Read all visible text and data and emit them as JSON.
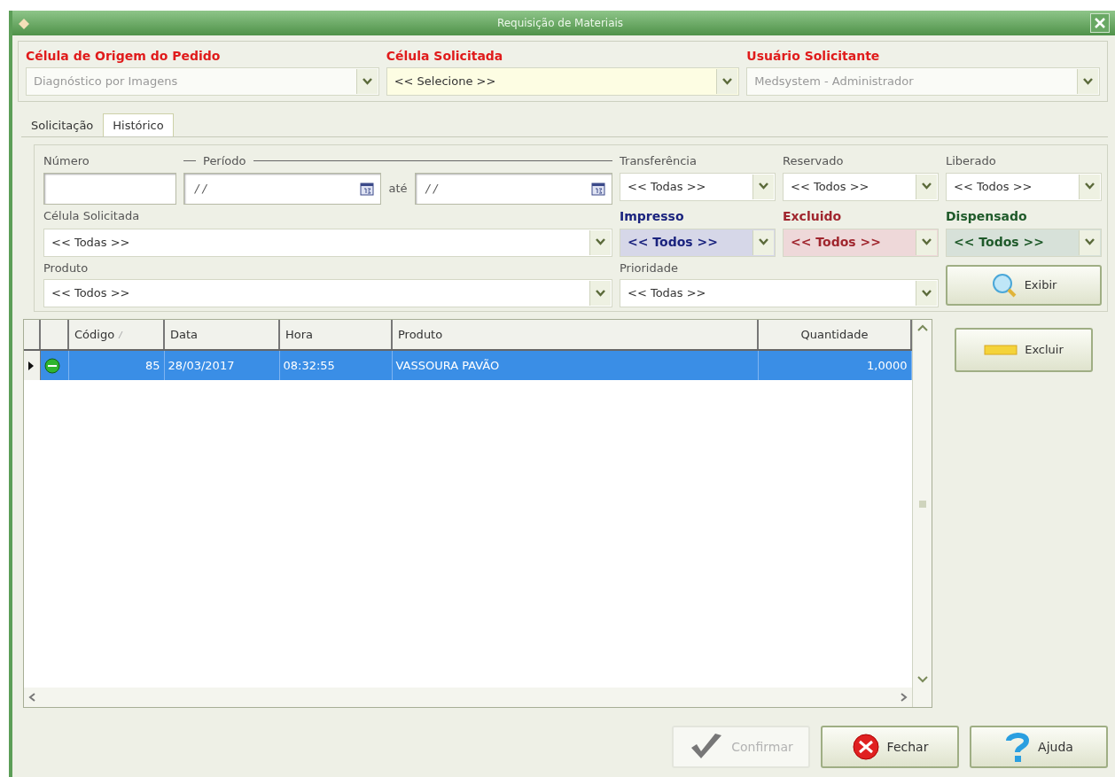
{
  "window": {
    "title": "Requisição de Materiais"
  },
  "header_fields": [
    {
      "label": "Célula de Origem do Pedido",
      "value": "Diagnóstico por Imagens",
      "disabled": true
    },
    {
      "label": "Célula Solicitada",
      "value": "<< Selecione >>",
      "disabled": false
    },
    {
      "label": "Usuário Solicitante",
      "value": "Medsystem - Administrador",
      "disabled": true
    }
  ],
  "tabs": [
    {
      "label": "Solicitação",
      "selected": false
    },
    {
      "label": "Histórico",
      "selected": true
    }
  ],
  "filters": {
    "number": {
      "label": "Número"
    },
    "period": {
      "label": "Período",
      "start": "/ /",
      "separator": "até",
      "end": "/ /"
    },
    "flag_filters": [
      {
        "label": "Transferência",
        "value": "<< Todas >>"
      },
      {
        "label": "Reservado",
        "value": "<< Todos >>"
      },
      {
        "label": "Liberado",
        "value": "<< Todos >>"
      }
    ],
    "cell": {
      "label": "Célula Solicitada",
      "value": "<< Todas >>"
    },
    "status_filters": [
      {
        "label": "Impresso",
        "value": "<< Todos >>",
        "color": "#1a237e"
      },
      {
        "label": "Excluido",
        "value": "<< Todos >>",
        "color": "#a0262e"
      },
      {
        "label": "Dispensado",
        "value": "<< Todos >>",
        "color": "#1f5a2a"
      }
    ],
    "product": {
      "label": "Produto",
      "value": "<< Todos >>"
    },
    "priority": {
      "label": "Prioridade",
      "value": "<< Todas >>"
    },
    "show_button": "Exibir"
  },
  "table": {
    "columns": [
      {
        "label": "Código",
        "sorted": true
      },
      {
        "label": "Data",
        "sorted": false
      },
      {
        "label": "Hora",
        "sorted": false
      },
      {
        "label": "Produto",
        "sorted": false
      },
      {
        "label": "Quantidade",
        "sorted": false
      }
    ],
    "rows": [
      {
        "selected": true,
        "color": "#2fb52f",
        "cells": [
          "85",
          "28/03/2017",
          "08:32:55",
          "VASSOURA PAVÃO",
          "1,0000"
        ]
      }
    ]
  },
  "side_buttons": [
    {
      "label": "Excluir"
    }
  ],
  "footer_buttons": [
    {
      "kind": "confirm",
      "label": "Confirmar",
      "disabled": true
    },
    {
      "kind": "close",
      "label": "Fechar",
      "disabled": false
    },
    {
      "kind": "help",
      "label": "Ajuda",
      "disabled": false
    }
  ]
}
